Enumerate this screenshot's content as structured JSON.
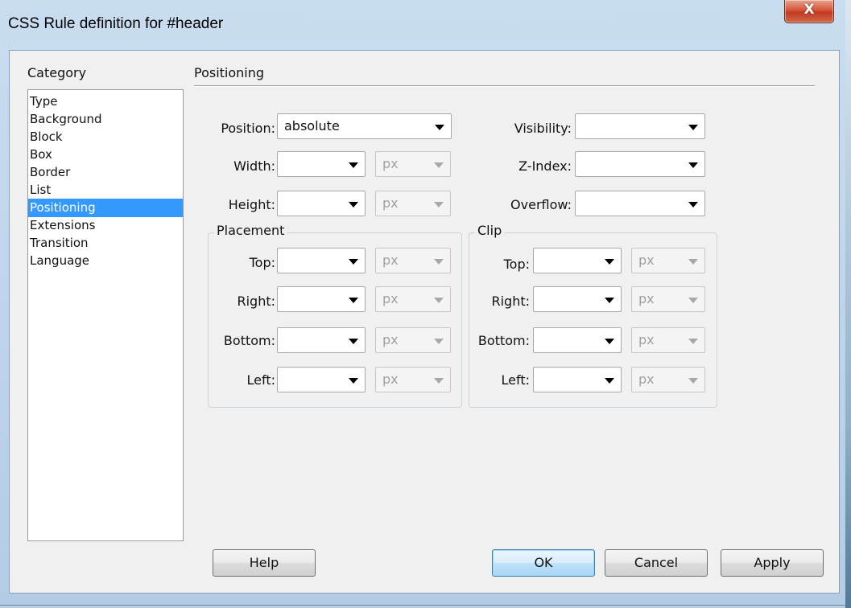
{
  "window": {
    "title": "CSS Rule definition for #header",
    "close_glyph": "X"
  },
  "category": {
    "label": "Category",
    "items": [
      "Type",
      "Background",
      "Block",
      "Box",
      "Border",
      "List",
      "Positioning",
      "Extensions",
      "Transition",
      "Language"
    ],
    "selected": "Positioning"
  },
  "section": {
    "title": "Positioning"
  },
  "fields": {
    "position": {
      "label": "Position:",
      "value": "absolute"
    },
    "width": {
      "label": "Width:",
      "value": "",
      "unit": "px"
    },
    "height": {
      "label": "Height:",
      "value": "",
      "unit": "px"
    },
    "visibility": {
      "label": "Visibility:",
      "value": ""
    },
    "zindex": {
      "label": "Z-Index:",
      "value": ""
    },
    "overflow": {
      "label": "Overflow:",
      "value": ""
    }
  },
  "placement": {
    "legend": "Placement",
    "top": {
      "label": "Top:",
      "value": "",
      "unit": "px"
    },
    "right": {
      "label": "Right:",
      "value": "",
      "unit": "px"
    },
    "bottom": {
      "label": "Bottom:",
      "value": "",
      "unit": "px"
    },
    "left": {
      "label": "Left:",
      "value": "",
      "unit": "px"
    }
  },
  "clip": {
    "legend": "Clip",
    "top": {
      "label": "Top:",
      "value": "",
      "unit": "px"
    },
    "right": {
      "label": "Right:",
      "value": "",
      "unit": "px"
    },
    "bottom": {
      "label": "Bottom:",
      "value": "",
      "unit": "px"
    },
    "left": {
      "label": "Left:",
      "value": "",
      "unit": "px"
    }
  },
  "buttons": {
    "help": "Help",
    "ok": "OK",
    "cancel": "Cancel",
    "apply": "Apply"
  },
  "colors": {
    "selection": "#3399ff",
    "close_button": "#c23a20",
    "default_button": "#3c7fb1"
  }
}
